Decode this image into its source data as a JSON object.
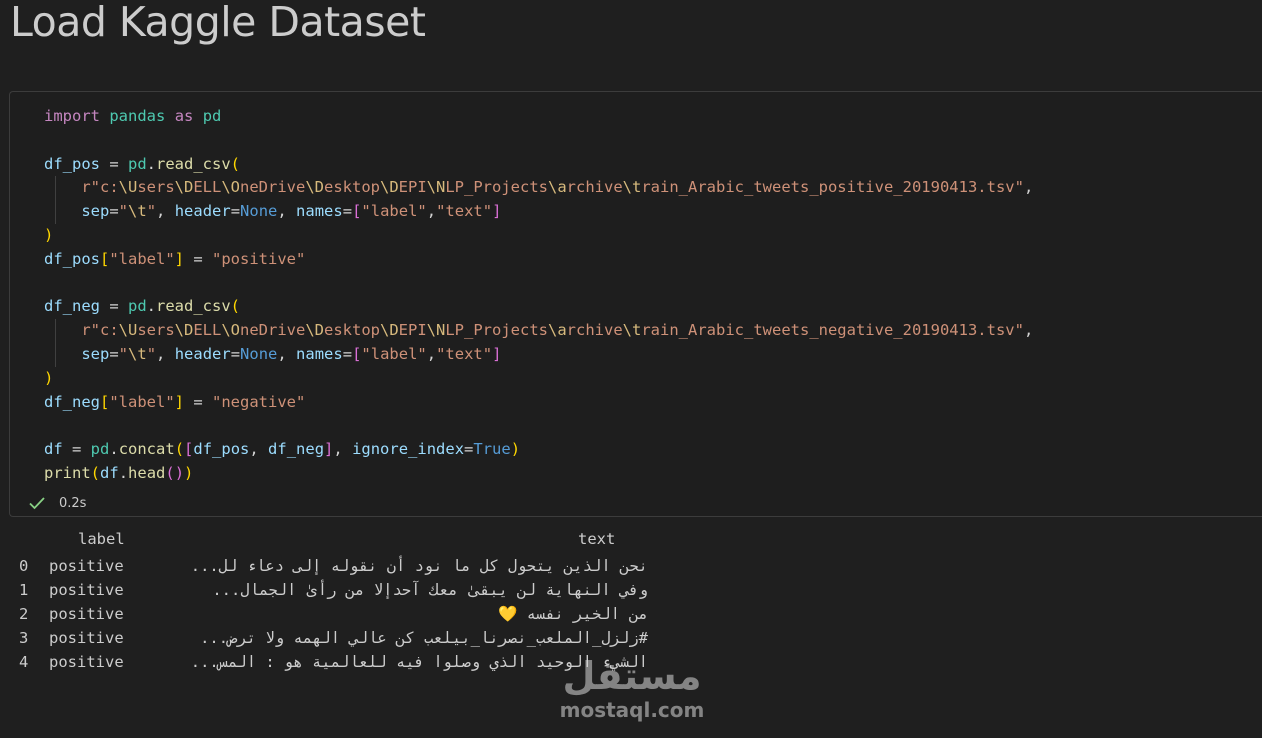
{
  "notebook": {
    "heading": "Load Kaggle Dataset",
    "cell": {
      "code_lines": [
        [
          {
            "t": "import",
            "c": "kw"
          },
          {
            "t": " "
          },
          {
            "t": "pandas",
            "c": "mod"
          },
          {
            "t": " "
          },
          {
            "t": "as",
            "c": "kw"
          },
          {
            "t": " "
          },
          {
            "t": "pd",
            "c": "mod"
          }
        ],
        [],
        [
          {
            "t": "df_pos",
            "c": "var"
          },
          {
            "t": " = "
          },
          {
            "t": "pd",
            "c": "mod"
          },
          {
            "t": "."
          },
          {
            "t": "read_csv",
            "c": "fn"
          },
          {
            "t": "(",
            "c": "p1"
          }
        ],
        [
          {
            "t": "    "
          },
          {
            "t": "r\"c:",
            "c": "str"
          },
          {
            "t": "\\U",
            "c": "esc"
          },
          {
            "t": "sers",
            "c": "str"
          },
          {
            "t": "\\D",
            "c": "esc"
          },
          {
            "t": "ELL",
            "c": "str"
          },
          {
            "t": "\\O",
            "c": "esc"
          },
          {
            "t": "neDrive",
            "c": "str"
          },
          {
            "t": "\\D",
            "c": "esc"
          },
          {
            "t": "esktop",
            "c": "str"
          },
          {
            "t": "\\D",
            "c": "esc"
          },
          {
            "t": "EPI",
            "c": "str"
          },
          {
            "t": "\\N",
            "c": "esc"
          },
          {
            "t": "LP_Projects",
            "c": "str"
          },
          {
            "t": "\\a",
            "c": "esc"
          },
          {
            "t": "rchive",
            "c": "str"
          },
          {
            "t": "\\t",
            "c": "esc"
          },
          {
            "t": "rain_Arabic_tweets_positive_20190413.tsv\"",
            "c": "str"
          },
          {
            "t": ","
          }
        ],
        [
          {
            "t": "    "
          },
          {
            "t": "sep",
            "c": "var"
          },
          {
            "t": "="
          },
          {
            "t": "\"",
            "c": "str"
          },
          {
            "t": "\\t",
            "c": "esc"
          },
          {
            "t": "\"",
            "c": "str"
          },
          {
            "t": ", "
          },
          {
            "t": "header",
            "c": "var"
          },
          {
            "t": "="
          },
          {
            "t": "None",
            "c": "const"
          },
          {
            "t": ", "
          },
          {
            "t": "names",
            "c": "var"
          },
          {
            "t": "="
          },
          {
            "t": "[",
            "c": "p2"
          },
          {
            "t": "\"label\"",
            "c": "str"
          },
          {
            "t": ","
          },
          {
            "t": "\"text\"",
            "c": "str"
          },
          {
            "t": "]",
            "c": "p2"
          }
        ],
        [
          {
            "t": ")",
            "c": "p1"
          }
        ],
        [
          {
            "t": "df_pos",
            "c": "var"
          },
          {
            "t": "[",
            "c": "p1"
          },
          {
            "t": "\"label\"",
            "c": "str"
          },
          {
            "t": "]",
            "c": "p1"
          },
          {
            "t": " = "
          },
          {
            "t": "\"positive\"",
            "c": "str"
          }
        ],
        [],
        [
          {
            "t": "df_neg",
            "c": "var"
          },
          {
            "t": " = "
          },
          {
            "t": "pd",
            "c": "mod"
          },
          {
            "t": "."
          },
          {
            "t": "read_csv",
            "c": "fn"
          },
          {
            "t": "(",
            "c": "p1"
          }
        ],
        [
          {
            "t": "    "
          },
          {
            "t": "r\"c:",
            "c": "str"
          },
          {
            "t": "\\U",
            "c": "esc"
          },
          {
            "t": "sers",
            "c": "str"
          },
          {
            "t": "\\D",
            "c": "esc"
          },
          {
            "t": "ELL",
            "c": "str"
          },
          {
            "t": "\\O",
            "c": "esc"
          },
          {
            "t": "neDrive",
            "c": "str"
          },
          {
            "t": "\\D",
            "c": "esc"
          },
          {
            "t": "esktop",
            "c": "str"
          },
          {
            "t": "\\D",
            "c": "esc"
          },
          {
            "t": "EPI",
            "c": "str"
          },
          {
            "t": "\\N",
            "c": "esc"
          },
          {
            "t": "LP_Projects",
            "c": "str"
          },
          {
            "t": "\\a",
            "c": "esc"
          },
          {
            "t": "rchive",
            "c": "str"
          },
          {
            "t": "\\t",
            "c": "esc"
          },
          {
            "t": "rain_Arabic_tweets_negative_20190413.tsv\"",
            "c": "str"
          },
          {
            "t": ","
          }
        ],
        [
          {
            "t": "    "
          },
          {
            "t": "sep",
            "c": "var"
          },
          {
            "t": "="
          },
          {
            "t": "\"",
            "c": "str"
          },
          {
            "t": "\\t",
            "c": "esc"
          },
          {
            "t": "\"",
            "c": "str"
          },
          {
            "t": ", "
          },
          {
            "t": "header",
            "c": "var"
          },
          {
            "t": "="
          },
          {
            "t": "None",
            "c": "const"
          },
          {
            "t": ", "
          },
          {
            "t": "names",
            "c": "var"
          },
          {
            "t": "="
          },
          {
            "t": "[",
            "c": "p2"
          },
          {
            "t": "\"label\"",
            "c": "str"
          },
          {
            "t": ","
          },
          {
            "t": "\"text\"",
            "c": "str"
          },
          {
            "t": "]",
            "c": "p2"
          }
        ],
        [
          {
            "t": ")",
            "c": "p1"
          }
        ],
        [
          {
            "t": "df_neg",
            "c": "var"
          },
          {
            "t": "[",
            "c": "p1"
          },
          {
            "t": "\"label\"",
            "c": "str"
          },
          {
            "t": "]",
            "c": "p1"
          },
          {
            "t": " = "
          },
          {
            "t": "\"negative\"",
            "c": "str"
          }
        ],
        [],
        [
          {
            "t": "df",
            "c": "var"
          },
          {
            "t": " = "
          },
          {
            "t": "pd",
            "c": "mod"
          },
          {
            "t": "."
          },
          {
            "t": "concat",
            "c": "fn"
          },
          {
            "t": "(",
            "c": "p1"
          },
          {
            "t": "[",
            "c": "p2"
          },
          {
            "t": "df_pos",
            "c": "var"
          },
          {
            "t": ", "
          },
          {
            "t": "df_neg",
            "c": "var"
          },
          {
            "t": "]",
            "c": "p2"
          },
          {
            "t": ", "
          },
          {
            "t": "ignore_index",
            "c": "var"
          },
          {
            "t": "="
          },
          {
            "t": "True",
            "c": "const"
          },
          {
            "t": ")",
            "c": "p1"
          }
        ],
        [
          {
            "t": "print",
            "c": "fn"
          },
          {
            "t": "(",
            "c": "p1"
          },
          {
            "t": "df",
            "c": "var"
          },
          {
            "t": "."
          },
          {
            "t": "head",
            "c": "fn"
          },
          {
            "t": "(",
            "c": "p2"
          },
          {
            "t": ")",
            "c": "p2"
          },
          {
            "t": ")",
            "c": "p1"
          }
        ]
      ],
      "status_icon": "check-icon",
      "execution_time": "0.2s"
    },
    "output": {
      "columns": [
        "label",
        "text"
      ],
      "rows": [
        {
          "index": "0",
          "label": "positive",
          "text": "نحن الذين يتحول كل ما نود أن نقوله إلى دعاء لل..."
        },
        {
          "index": "1",
          "label": "positive",
          "text": "وفي النهاية لن يبقىٰ معك آحدإلا من رأىٰ الجمال..."
        },
        {
          "index": "2",
          "label": "positive",
          "text": "من الخير نفسه 💛"
        },
        {
          "index": "3",
          "label": "positive",
          "text": "#زلزل_الملعب_نصرنا_بيلعب كن عالي الهمه ولا ترض..."
        },
        {
          "index": "4",
          "label": "positive",
          "text": "الشيء الوحيد الذي وصلوا فيه للعالمية هو : المس..."
        }
      ]
    },
    "watermark": {
      "arabic": "مستقل",
      "latin": "mostaql.com"
    },
    "colors": {
      "background": "#1f1f1f",
      "cell_background": "#1e1e1e",
      "success_check": "#89d185"
    }
  }
}
